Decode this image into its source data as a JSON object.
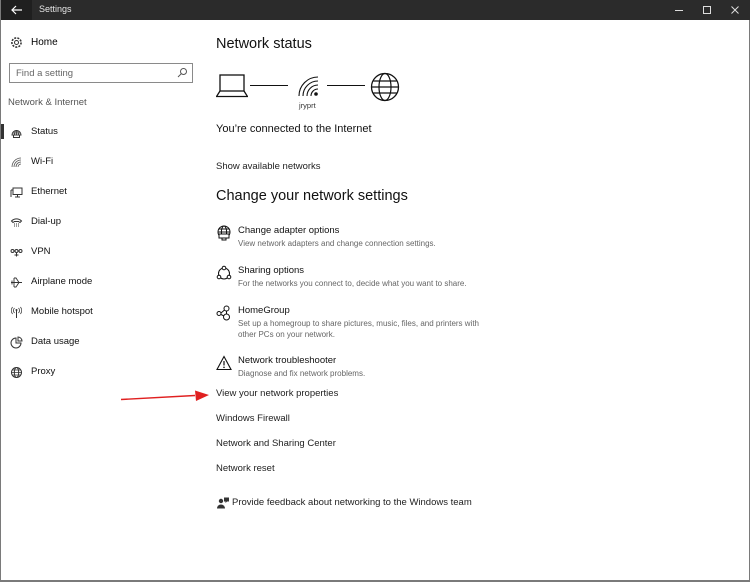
{
  "titlebar": {
    "title": "Settings",
    "back_icon": "back-arrow-icon",
    "controls": [
      "minimize-icon",
      "maximize-icon",
      "close-icon"
    ]
  },
  "sidebar": {
    "home_label": "Home",
    "home_icon": "gear-icon",
    "search_placeholder": "Find a setting",
    "search_icon": "search-icon",
    "section": "Network & Internet",
    "items": [
      {
        "label": "Status",
        "icon": "status-globe-icon",
        "active": true
      },
      {
        "label": "Wi-Fi",
        "icon": "wifi-icon"
      },
      {
        "label": "Ethernet",
        "icon": "ethernet-icon"
      },
      {
        "label": "Dial-up",
        "icon": "dialup-icon"
      },
      {
        "label": "VPN",
        "icon": "vpn-icon"
      },
      {
        "label": "Airplane mode",
        "icon": "airplane-icon"
      },
      {
        "label": "Mobile hotspot",
        "icon": "hotspot-icon"
      },
      {
        "label": "Data usage",
        "icon": "data-usage-icon"
      },
      {
        "label": "Proxy",
        "icon": "globe-icon"
      }
    ]
  },
  "main": {
    "status_heading": "Network status",
    "network_name": "jryprt",
    "connected_text": "You’re connected to the Internet",
    "show_networks": "Show available networks",
    "change_heading": "Change your network settings",
    "options": [
      {
        "title": "Change adapter options",
        "desc": "View network adapters and change connection settings.",
        "icon": "adapter-icon"
      },
      {
        "title": "Sharing options",
        "desc": "For the networks you connect to, decide what you want to share.",
        "icon": "sharing-icon"
      },
      {
        "title": "HomeGroup",
        "desc": "Set up a homegroup to share pictures, music, files, and printers with other PCs on your network.",
        "icon": "homegroup-icon"
      },
      {
        "title": "Network troubleshooter",
        "desc": "Diagnose and fix network problems.",
        "icon": "warning-icon"
      }
    ],
    "links": [
      "View your network properties",
      "Windows Firewall",
      "Network and Sharing Center",
      "Network reset"
    ],
    "feedback": "Provide feedback about networking to the Windows team"
  },
  "annotation": {
    "arrow_color": "#e02020"
  }
}
